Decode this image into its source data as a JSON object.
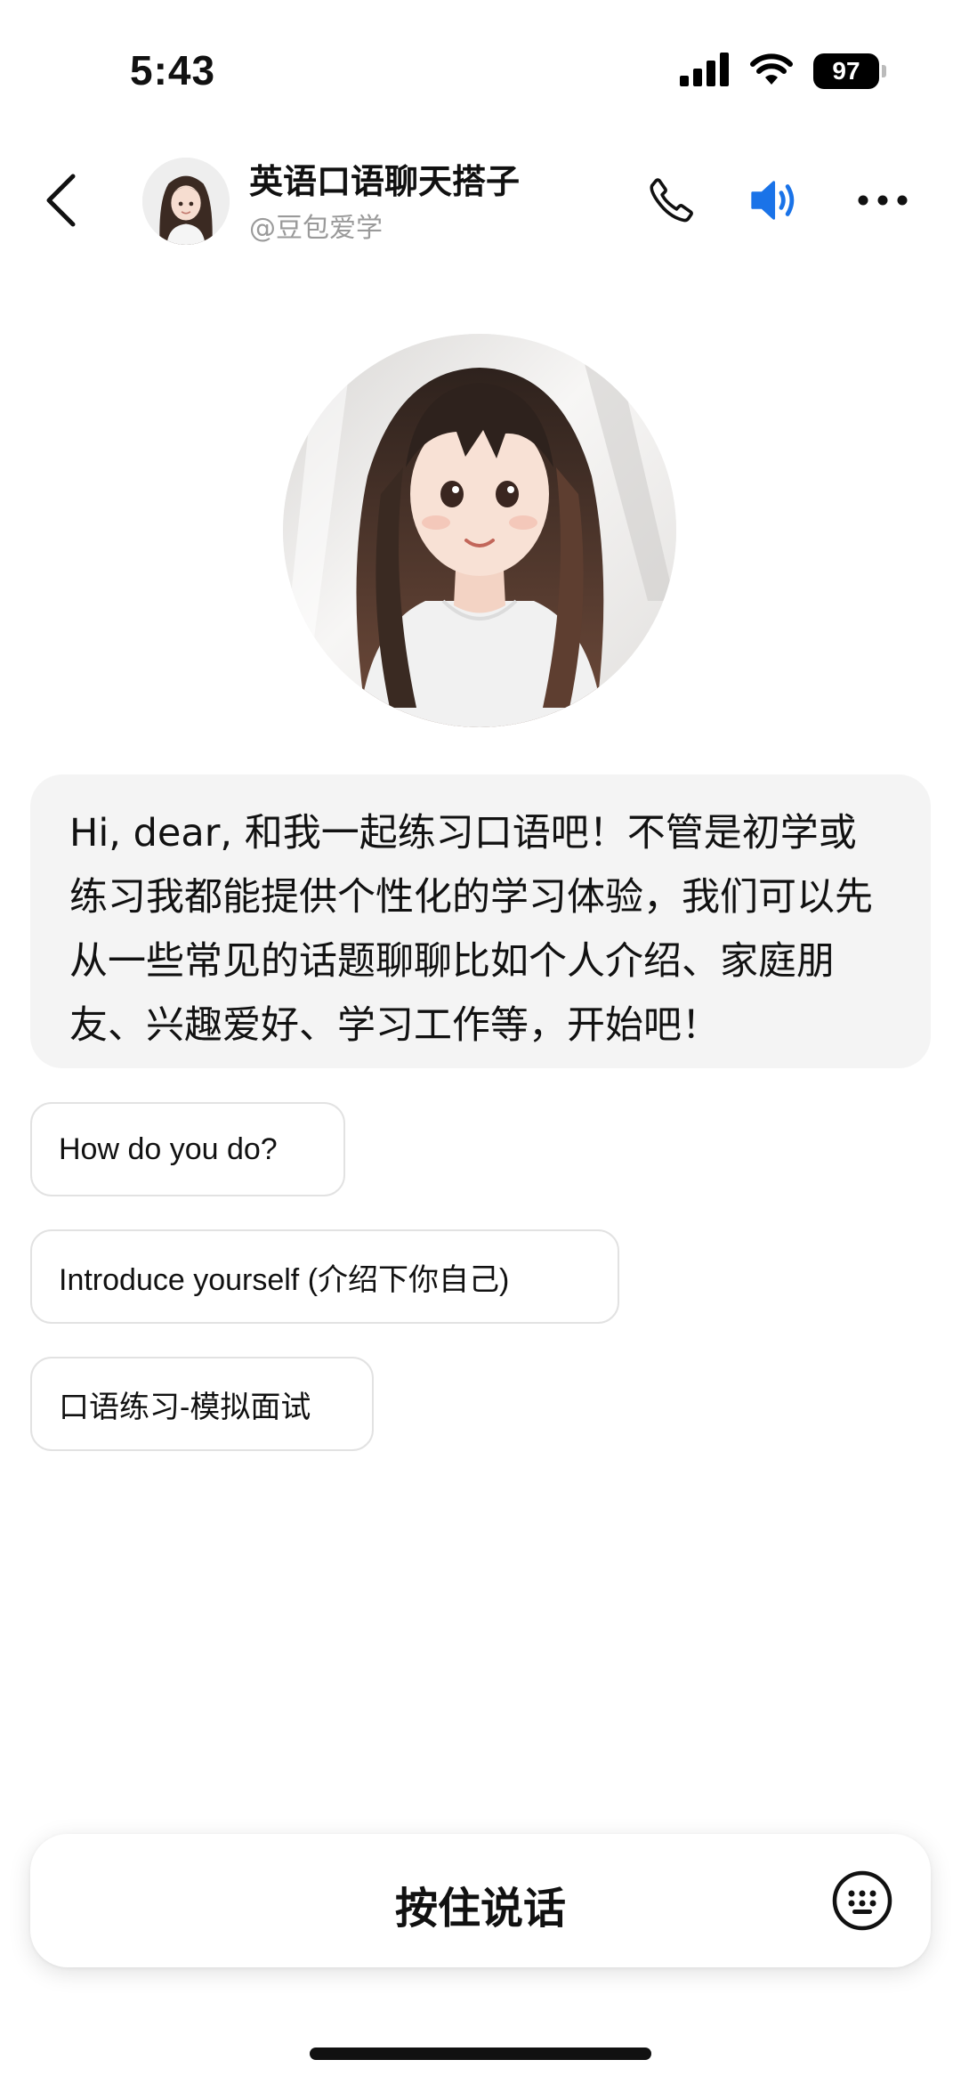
{
  "status_bar": {
    "time": "5:43",
    "battery": "97",
    "icons": [
      "signal-icon",
      "wifi-icon",
      "battery-icon"
    ]
  },
  "header": {
    "title": "英语口语聊天搭子",
    "subtitle": "@豆包爱学",
    "icons": [
      "back-chevron-icon",
      "phone-icon",
      "speaker-icon",
      "more-icon"
    ],
    "accent": "#1a73e8"
  },
  "message": {
    "text": "Hi, dear, 和我一起练习口语吧！不管是初学或练习我都能提供个性化的学习体验，我们可以先从一些常见的话题聊聊比如个人介绍、家庭朋友、兴趣爱好、学习工作等，开始吧！"
  },
  "suggestions": [
    {
      "label": "How do you do?"
    },
    {
      "label": "Introduce yourself (介绍下你自己)"
    },
    {
      "label": "口语练习-模拟面试"
    }
  ],
  "input": {
    "hold_to_talk_label": "按住说话",
    "keyboard_icon": "keyboard-icon"
  }
}
